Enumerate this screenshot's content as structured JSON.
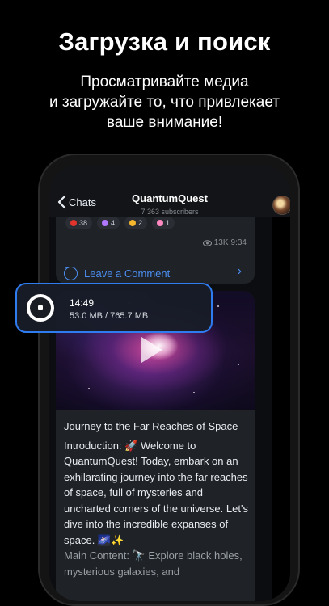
{
  "promo": {
    "headline": "Загрузка и поиск",
    "subline": [
      "Просматривайте медиа",
      "и загружайте то, что привлекает",
      "ваше внимание!"
    ]
  },
  "chat": {
    "back_label": "Chats",
    "title": "QuantumQuest",
    "subscribers": "7 363 subscribers"
  },
  "previous_post": {
    "reactions": [
      {
        "count": "38",
        "color": "#e0342d"
      },
      {
        "count": "4",
        "color": "#b077ff"
      },
      {
        "count": "2",
        "color": "#f4b72d"
      },
      {
        "count": "1",
        "color": "#ff8ac2"
      }
    ],
    "views": "13K",
    "time": "9:34",
    "comment_label": "Leave a Comment"
  },
  "download": {
    "time": "14:49",
    "size": "53.0 MB / 765.7 MB"
  },
  "post": {
    "title": "Journey to the Far Reaches of Space",
    "body": "Introduction: 🚀 Welcome to QuantumQuest! Today, embark on an exhilarating journey into the far reaches of space, full of mysteries and uncharted corners of the universe. Let's dive into the incredible expanses of space. 🌌✨",
    "body_dim": "Main Content: 🔭 Explore black holes, mysterious galaxies, and"
  },
  "icons": [
    "chevron-left-icon",
    "eye-icon",
    "comment-icon",
    "chevron-right-icon",
    "play-icon",
    "stop-icon"
  ],
  "colors": {
    "accent": "#2f7bf0",
    "link": "#4c8ef0",
    "bubble": "#1f2226"
  }
}
